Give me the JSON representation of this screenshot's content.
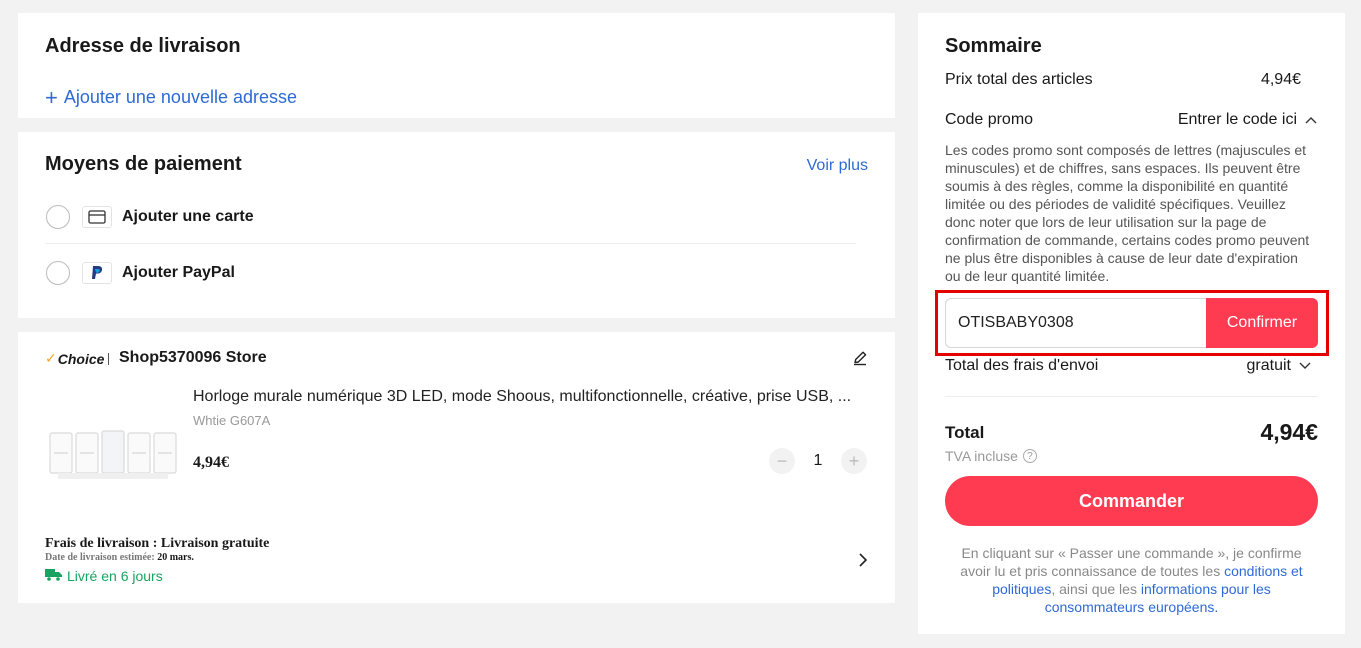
{
  "address": {
    "title": "Adresse de livraison",
    "add_label": "Ajouter une nouvelle adresse"
  },
  "payment": {
    "title": "Moyens de paiement",
    "more_label": "Voir plus",
    "methods": [
      {
        "label": "Ajouter une carte",
        "icon": "credit-card-icon"
      },
      {
        "label": "Ajouter PayPal",
        "icon": "paypal-icon"
      }
    ]
  },
  "order": {
    "choice_label": "Choice",
    "store": "Shop5370096 Store",
    "product_title": "Horloge murale numérique 3D LED, mode Shoous, multifonctionnelle, créative, prise USB, ...",
    "variant": "Whtie G607A",
    "price": "4,94€",
    "quantity": "1",
    "shipping_title": "Frais de livraison : Livraison gratuite",
    "delivery_date_prefix": "Date de livraison estimée:",
    "delivery_date": "20 mars.",
    "delivery_days": "Livré en 6 jours"
  },
  "summary": {
    "title": "Sommaire",
    "items_total_label": "Prix total des articles",
    "items_total": "4,94€",
    "promo_label": "Code promo",
    "promo_toggle": "Entrer le code ici",
    "promo_description": "Les codes promo sont composés de lettres (majuscules et minuscules) et de chiffres, sans espaces. Ils peuvent être soumis à des règles, comme la disponibilité en quantité limitée ou des périodes de validité spécifiques. Veuillez donc noter que lors de leur utilisation sur la page de confirmation de commande, certains codes promo peuvent ne plus être disponibles à cause de leur date d'expiration ou de leur quantité limitée.",
    "promo_value": "OTISBABY0308",
    "promo_confirm": "Confirmer",
    "shipping_label": "Total des frais d'envoi",
    "shipping_value": "gratuit",
    "total_label": "Total",
    "total_value": "4,94€",
    "tva_label": "TVA incluse",
    "order_button": "Commander",
    "legal_prefix": "En cliquant sur « Passer une commande », je confirme avoir lu et pris connaissance de toutes les ",
    "legal_link1": "conditions et politiques",
    "legal_middle": ", ainsi que les ",
    "legal_link2": "informations pour les consommateurs européens."
  },
  "colors": {
    "accent": "#ff3b52",
    "link": "#2e6ad6",
    "highlight_border": "#e50000",
    "delivery_green": "#1aa260"
  }
}
